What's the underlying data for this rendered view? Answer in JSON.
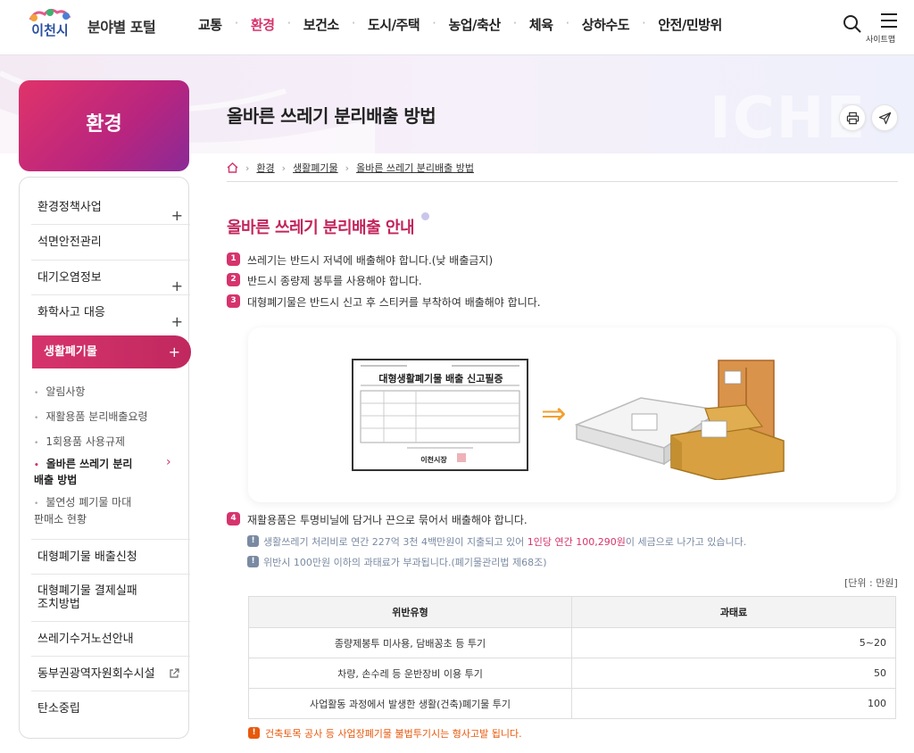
{
  "header": {
    "logo_text": "이천시",
    "portal_title": "분야별 포털",
    "nav": [
      "교통",
      "환경",
      "보건소",
      "도시/주택",
      "농업/축산",
      "체육",
      "상하수도",
      "안전/민방위"
    ],
    "nav_active_index": 1,
    "sitemap_label": "사이트맵"
  },
  "hero": {
    "watermark": "ICHE"
  },
  "sidebar": {
    "title": "환경",
    "items": [
      {
        "label": "환경정책사업",
        "expand": "+"
      },
      {
        "label": "석면안전관리",
        "expand": ""
      },
      {
        "label": "대기오염정보",
        "expand": "+"
      },
      {
        "label": "화학사고 대응",
        "expand": "+"
      }
    ],
    "active_item": {
      "label": "생활폐기물",
      "expand": "+"
    },
    "subitems": [
      "알림사항",
      "재활용품 분리배출요령",
      "1회용품 사용규제",
      "올바른 쓰레기 분리배출 방법",
      "불연성 폐기물 마대 판매소 현황"
    ],
    "subitem_current_index": 3,
    "subitem_current_arrow": "›",
    "bottom_items": [
      "대형폐기물 배출신청",
      "대형폐기물 결제실패 조치방법",
      "쓰레기수거노선안내",
      "동부권광역자원회수시설",
      "탄소중립"
    ],
    "external_link_index": 3
  },
  "main": {
    "page_title": "올바른 쓰레기 분리배출 방법",
    "breadcrumb": [
      "환경",
      "생활폐기물",
      "올바른 쓰레기 분리배출 방법"
    ],
    "section_title": "올바른 쓰레기 분리배출 안내",
    "rules": [
      {
        "num": "1",
        "text": "쓰레기는 반드시 저녁에 배출해야 합니다.(낮 배출금지)"
      },
      {
        "num": "2",
        "text": "반드시 종량제 봉투를 사용해야 합니다."
      },
      {
        "num": "3",
        "text": "대형폐기물은 반드시 신고 후 스티커를 부착하여 배출해야 합니다."
      },
      {
        "num": "4",
        "text": "재활용품은 투명비닐에 담거나 끈으로 묶어서 배출해야 합니다."
      }
    ],
    "illustration": {
      "notice_title": "대형생활폐기물 배출 신고필증",
      "notice_sign": "이천시장",
      "arrow": "⇒"
    },
    "notes": {
      "note1_a": "생활쓰레기 처리비로 연간 227억 3천 4백만원이 지출되고 있어 ",
      "note1_b": "1인당 연간 100,290원",
      "note1_c": "이 세금으로 나가고 있습니다.",
      "note2": "위반시 100만원 이하의 과태료가 부과됩니다.(폐기물관리법 제68조)"
    },
    "unit": "[단위 : 만원]",
    "table": {
      "headers": [
        "위반유형",
        "과태료"
      ],
      "rows": [
        [
          "종량제봉투 미사용, 담배꽁초 등 투기",
          "5~20"
        ],
        [
          "차량, 손수레 등 운반장비 이용 투기",
          "50"
        ],
        [
          "사업활동 과정에서 발생한 생활(건축)폐기물 투기",
          "100"
        ]
      ]
    },
    "warning": "건축토목 공사 등 사업장폐기물 불법투기시는 형사고발 됩니다."
  },
  "colors": {
    "accent": "#d6336c",
    "note_grey": "#7a8aa3",
    "warning": "#e8590c"
  }
}
